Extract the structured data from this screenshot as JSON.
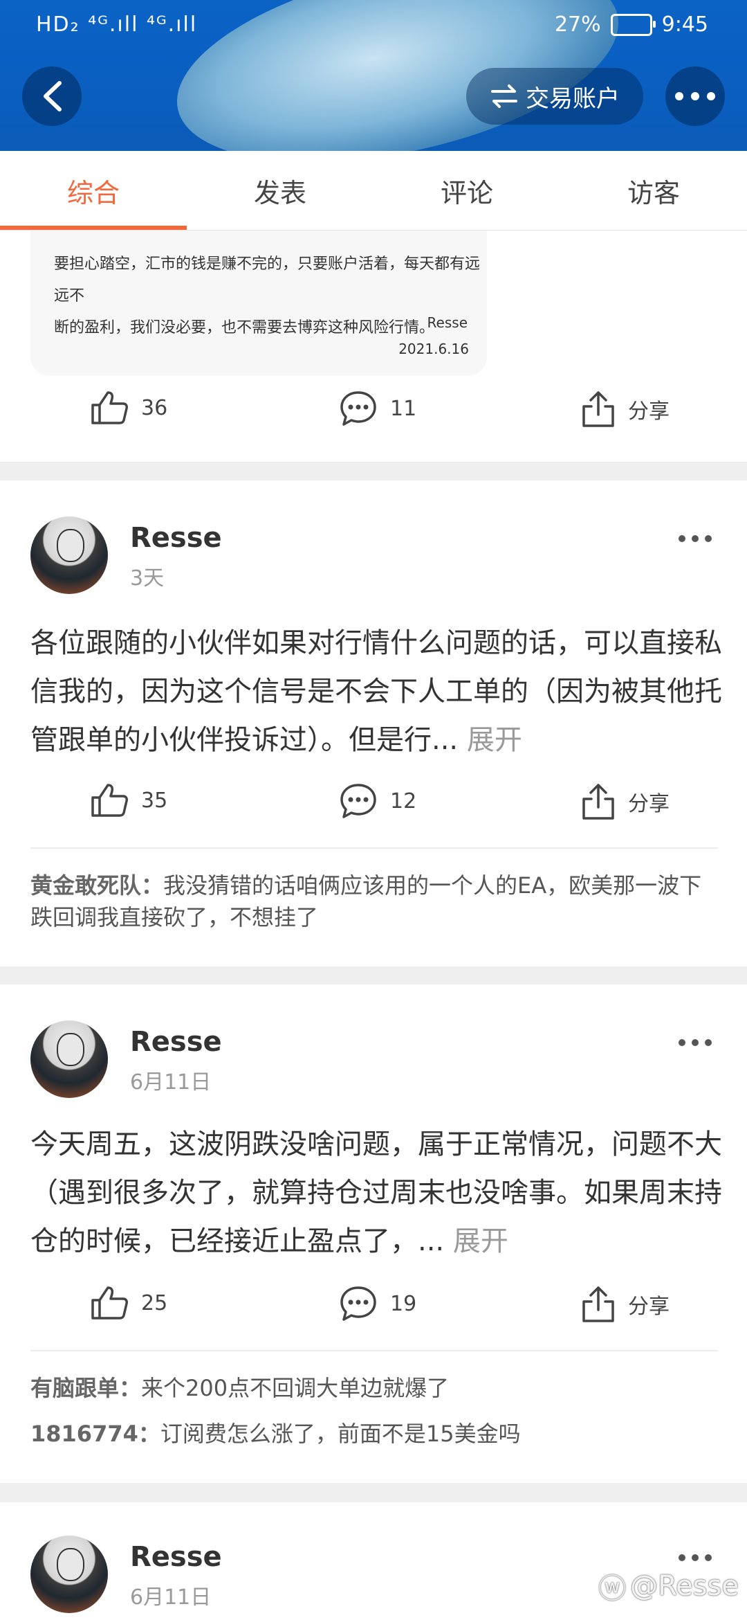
{
  "status_bar": {
    "left": "HD₂ ⁴ᴳ.ıll ⁴ᴳ.ıll",
    "battery": "27%",
    "time": "9:45"
  },
  "header": {
    "back_icon": "back-arrow-icon",
    "trade_label": "交易账户",
    "more_icon": "more-dots-icon"
  },
  "tabs": [
    "综合",
    "发表",
    "评论",
    "访客"
  ],
  "active_tab": 0,
  "preview_card": {
    "lines": [
      "要担心踏空，汇市的钱是赚不完的，只要账户活着，每天都有远远不",
      "断的盈利，我们没必要，也不需要去博弈这种风险行情。"
    ],
    "signature": "Resse",
    "date": "2021.6.16",
    "likes": "36",
    "comments": "11",
    "share": "分享"
  },
  "posts": [
    {
      "author": "Resse",
      "time": "3天",
      "text": "各位跟随的小伙伴如果对行情什么问题的话，可以直接私信我的，因为这个信号是不会下人工单的（因为被其他托管跟单的小伙伴投诉过）。但是行...",
      "expand": "展开",
      "likes": "35",
      "comments": "12",
      "share": "分享",
      "replies": [
        {
          "who": "黄金敢死队：",
          "text": "我没猜错的话咱俩应该用的一个人的EA，欧美那一波下跌回调我直接砍了，不想挂了"
        }
      ]
    },
    {
      "author": "Resse",
      "time": "6月11日",
      "text": "今天周五，这波阴跌没啥问题，属于正常情况，问题不大（遇到很多次了，就算持仓过周末也没啥事。如果周末持仓的时候，已经接近止盈点了，...",
      "expand": "展开",
      "likes": "25",
      "comments": "19",
      "share": "分享",
      "replies": [
        {
          "who": "有脑跟单：",
          "text": "来个200点不回调大单边就爆了"
        },
        {
          "who": "1816774：",
          "text": "订阅费怎么涨了，前面不是15美金吗"
        }
      ]
    },
    {
      "author": "Resse",
      "time": "6月11日"
    }
  ],
  "watermark": "@Resse"
}
